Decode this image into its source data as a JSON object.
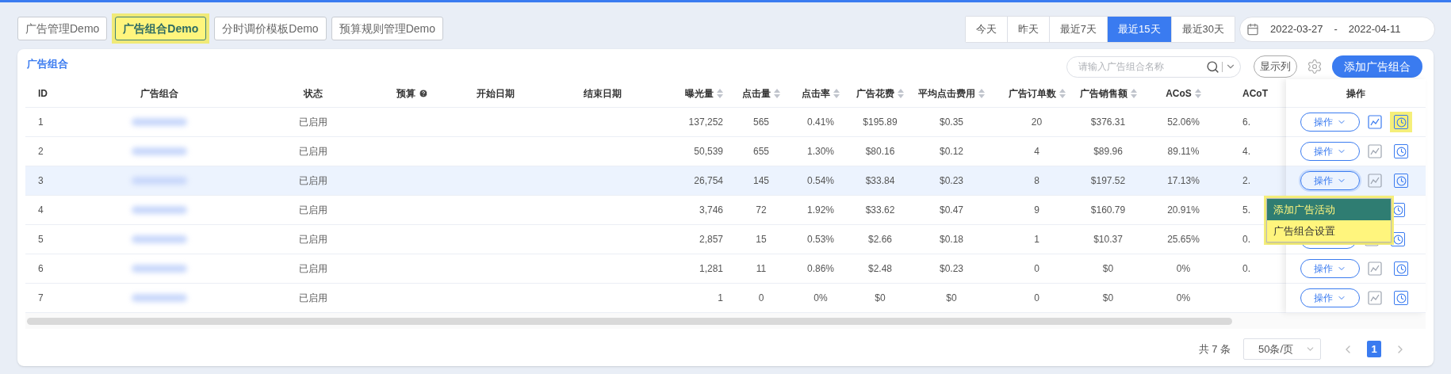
{
  "nav_tabs": [
    {
      "label": "广告管理Demo",
      "selected": false
    },
    {
      "label": "广告组合Demo",
      "selected": true
    },
    {
      "label": "分时调价模板Demo",
      "selected": false
    },
    {
      "label": "预算规则管理Demo",
      "selected": false
    }
  ],
  "date_tabs": [
    {
      "label": "今天",
      "selected": false
    },
    {
      "label": "昨天",
      "selected": false
    },
    {
      "label": "最近7天",
      "selected": false
    },
    {
      "label": "最近15天",
      "selected": true
    },
    {
      "label": "最近30天",
      "selected": false
    }
  ],
  "date_range": {
    "start": "2022-03-27",
    "separator": "-",
    "end": "2022-04-11"
  },
  "card": {
    "title": "广告组合",
    "search": {
      "placeholder": "请输入广告组合名称"
    },
    "columns_button": "显示列",
    "add_button": "添加广告组合"
  },
  "columns": [
    {
      "label": "ID",
      "kind": "plain"
    },
    {
      "label": "广告组合",
      "kind": "plain"
    },
    {
      "label": "状态",
      "kind": "plain"
    },
    {
      "label": "预算",
      "kind": "help"
    },
    {
      "label": "开始日期",
      "kind": "plain"
    },
    {
      "label": "结束日期",
      "kind": "plain"
    },
    {
      "label": "曝光量",
      "kind": "sortable"
    },
    {
      "label": "点击量",
      "kind": "sortable"
    },
    {
      "label": "点击率",
      "kind": "sortable"
    },
    {
      "label": "广告花费",
      "kind": "sortable"
    },
    {
      "label": "平均点击费用",
      "kind": "sortable"
    },
    {
      "label": "广告订单数",
      "kind": "sortable"
    },
    {
      "label": "广告销售额",
      "kind": "sortable"
    },
    {
      "label": "ACoS",
      "kind": "sortable"
    },
    {
      "label": "ACoT",
      "kind": "plain"
    },
    {
      "label": "操作",
      "kind": "plain"
    }
  ],
  "rows": [
    {
      "id": "1",
      "status": "已启用",
      "impressions": "137,252",
      "clicks": "565",
      "ctr": "0.41%",
      "spend": "$195.89",
      "cpc": "$0.35",
      "orders": "20",
      "sales": "$376.31",
      "acos": "52.06%",
      "acot": "6.",
      "action": "操作",
      "selected": false,
      "chart_active": true,
      "clock_highlighted": true
    },
    {
      "id": "2",
      "status": "已启用",
      "impressions": "50,539",
      "clicks": "655",
      "ctr": "1.30%",
      "spend": "$80.16",
      "cpc": "$0.12",
      "orders": "4",
      "sales": "$89.96",
      "acos": "89.11%",
      "acot": "4.",
      "action": "操作",
      "selected": false,
      "chart_active": false,
      "clock_highlighted": false
    },
    {
      "id": "3",
      "status": "已启用",
      "impressions": "26,754",
      "clicks": "145",
      "ctr": "0.54%",
      "spend": "$33.84",
      "cpc": "$0.23",
      "orders": "8",
      "sales": "$197.52",
      "acos": "17.13%",
      "acot": "2.",
      "action": "操作",
      "selected": true,
      "chart_active": false,
      "clock_highlighted": false
    },
    {
      "id": "4",
      "status": "已启用",
      "impressions": "3,746",
      "clicks": "72",
      "ctr": "1.92%",
      "spend": "$33.62",
      "cpc": "$0.47",
      "orders": "9",
      "sales": "$160.79",
      "acos": "20.91%",
      "acot": "5.",
      "selected": false,
      "clock_highlighted": false
    },
    {
      "id": "5",
      "status": "已启用",
      "impressions": "2,857",
      "clicks": "15",
      "ctr": "0.53%",
      "spend": "$2.66",
      "cpc": "$0.18",
      "orders": "1",
      "sales": "$10.37",
      "acos": "25.65%",
      "acot": "0.",
      "selected": false,
      "chart_active": false,
      "clock_highlighted": false
    },
    {
      "id": "6",
      "status": "已启用",
      "impressions": "1,281",
      "clicks": "11",
      "ctr": "0.86%",
      "spend": "$2.48",
      "cpc": "$0.23",
      "orders": "0",
      "sales": "$0",
      "acos": "0%",
      "acot": "0.",
      "action": "操作",
      "selected": false,
      "chart_active": false,
      "clock_highlighted": false
    },
    {
      "id": "7",
      "status": "已启用",
      "impressions": "1",
      "clicks": "0",
      "ctr": "0%",
      "spend": "$0",
      "cpc": "$0",
      "orders": "0",
      "sales": "$0",
      "acos": "0%",
      "action": "操作",
      "selected": false,
      "chart_active": false,
      "clock_highlighted": false
    }
  ],
  "action_menu": {
    "items": [
      {
        "label": "添加广告活动",
        "selected": true
      },
      {
        "label": "广告组合设置",
        "selected": false
      }
    ]
  },
  "pagination": {
    "total": "共 7 条",
    "page_size": "50条/页",
    "pages": [
      {
        "label": "1",
        "selected": true
      }
    ]
  }
}
